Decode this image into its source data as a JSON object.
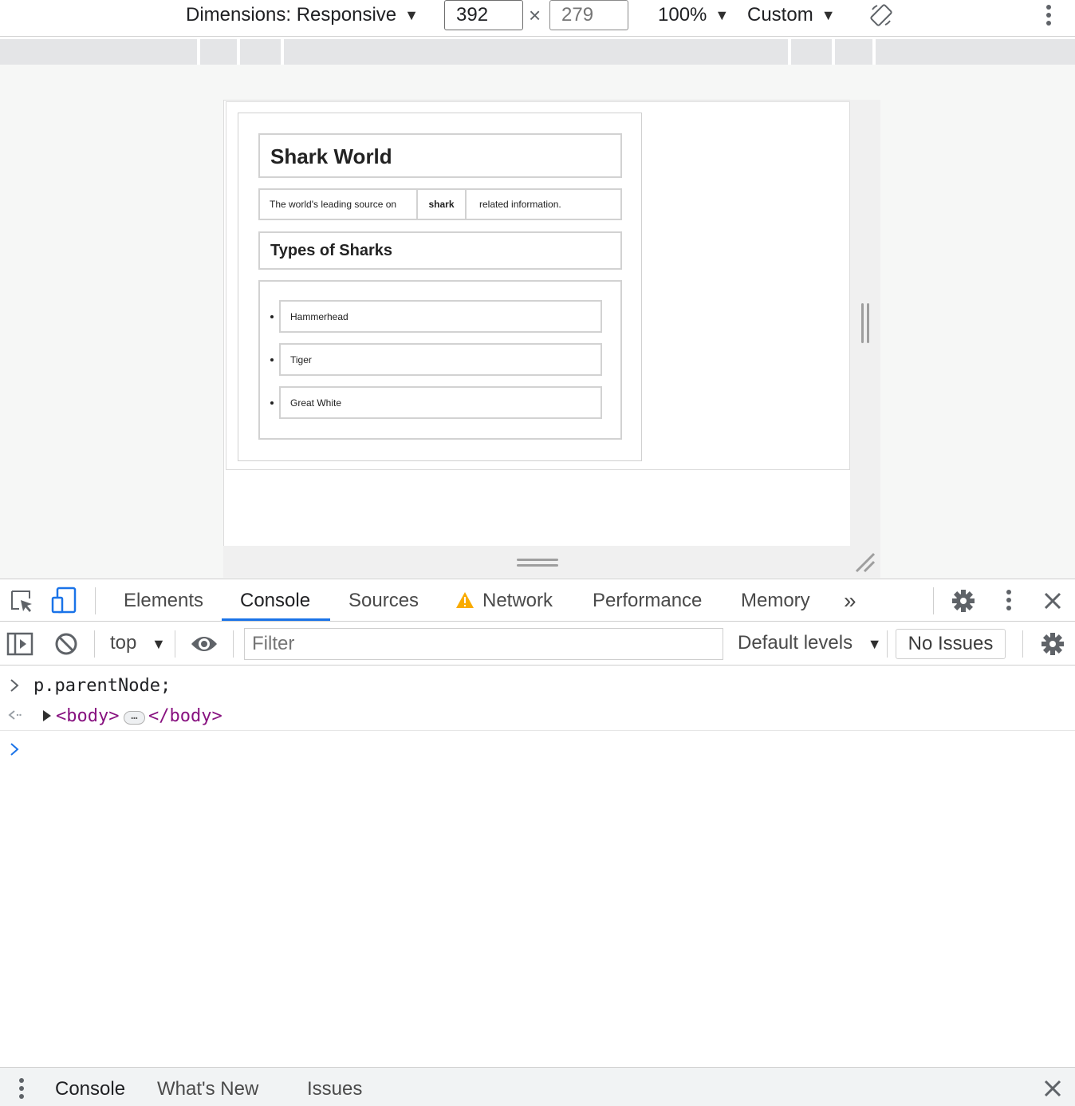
{
  "device_toolbar": {
    "dimensions_label": "Dimensions: Responsive",
    "width_value": "392",
    "times": "×",
    "height_placeholder": "279",
    "zoom": "100%",
    "throttle": "Custom",
    "caret": "▼",
    "rotate_icon": "rotate-icon",
    "more_icon": "more-vert-icon"
  },
  "page": {
    "site_title": "Shark World",
    "tagline_part1": "The world's leading source on",
    "tagline_part2": "shark",
    "tagline_part3": "related information.",
    "types_heading": "Types of Sharks",
    "sharks": [
      "Hammerhead",
      "Tiger",
      "Great White"
    ]
  },
  "devtools": {
    "tabs": [
      "Elements",
      "Console",
      "Sources",
      "Network",
      "Performance",
      "Memory"
    ],
    "active_tab": "Console",
    "more_tabs": "»",
    "accent": "#1a73e8",
    "warning_color": "#f9ab00"
  },
  "console_toolbar": {
    "context": "top",
    "filter_placeholder": "Filter",
    "levels": "Default levels",
    "issues": "No Issues"
  },
  "console": {
    "input_command": "p.parentNode;",
    "result_open": "<body>",
    "result_ellipsis": "…",
    "result_close": "</body>",
    "tag_color": "#881280"
  },
  "drawer": {
    "tabs": [
      "Console",
      "What's New",
      "Issues"
    ]
  }
}
